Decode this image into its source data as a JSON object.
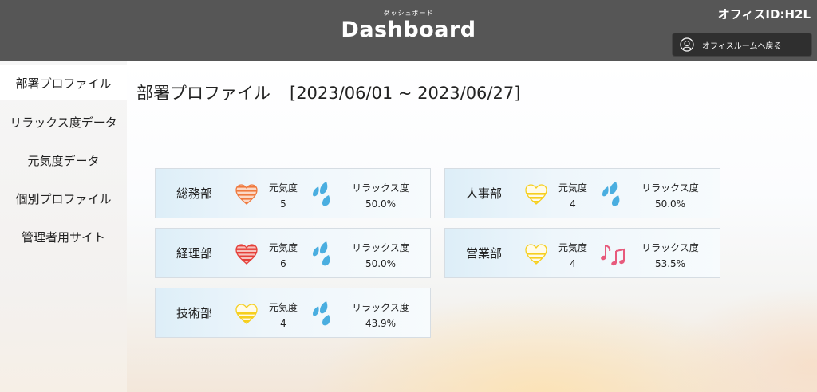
{
  "header": {
    "subtitle": "ダッシュボード",
    "title": "Dashboard",
    "office_id": "オフィスID:H2L",
    "back_button_label": "オフィスルームへ戻る"
  },
  "sidebar": {
    "items": [
      {
        "label": "部署プロファイル",
        "active": true
      },
      {
        "label": "リラックス度データ",
        "active": false
      },
      {
        "label": "元気度データ",
        "active": false
      },
      {
        "label": "個別プロファイル",
        "active": false
      },
      {
        "label": "管理者用サイト",
        "active": false
      }
    ]
  },
  "main": {
    "title": "部署プロファイル",
    "date_range": "[2023/06/01 ~ 2023/06/27]",
    "departments": [
      {
        "name": "総務部",
        "genki_label": "元気度",
        "genki": "5",
        "heart": "orange-striped-heart-icon",
        "relax_label": "リラックス度",
        "relax": "50.0%",
        "relax_icon": "water-drops-icon"
      },
      {
        "name": "人事部",
        "genki_label": "元気度",
        "genki": "4",
        "heart": "yellow-half-heart-icon",
        "relax_label": "リラックス度",
        "relax": "50.0%",
        "relax_icon": "water-drops-icon"
      },
      {
        "name": "経理部",
        "genki_label": "元気度",
        "genki": "6",
        "heart": "red-striped-heart-icon",
        "relax_label": "リラックス度",
        "relax": "50.0%",
        "relax_icon": "water-drops-icon"
      },
      {
        "name": "営業部",
        "genki_label": "元気度",
        "genki": "4",
        "heart": "yellow-half-heart-icon",
        "relax_label": "リラックス度",
        "relax": "53.5%",
        "relax_icon": "music-notes-icon"
      },
      {
        "name": "技術部",
        "genki_label": "元気度",
        "genki": "4",
        "heart": "yellow-half-heart-icon",
        "relax_label": "リラックス度",
        "relax": "43.9%",
        "relax_icon": "water-drops-icon"
      }
    ]
  },
  "colors": {
    "header_bg": "#565656",
    "heart_orange": "#ef7a3f",
    "heart_red": "#e5403a",
    "heart_yellow": "#f6cf1f",
    "drop_blue": "#4aaee0",
    "note_pink": "#e75a7c"
  }
}
